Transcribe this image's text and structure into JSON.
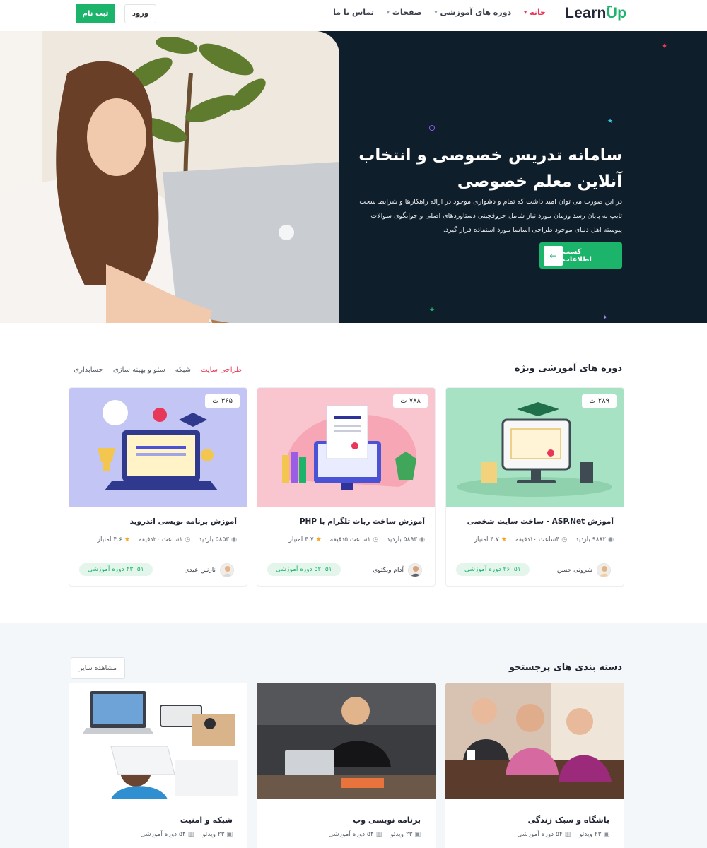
{
  "header": {
    "logo_main": "Learn",
    "logo_accent": "Up",
    "nav": [
      {
        "label": "خانه",
        "has_dropdown": true
      },
      {
        "label": "دوره های آموزشی",
        "has_dropdown": true
      },
      {
        "label": "صفحات",
        "has_dropdown": true
      },
      {
        "label": "تماس با ما",
        "has_dropdown": false
      }
    ],
    "login_label": "ورود",
    "register_label": "ثبت نام"
  },
  "hero": {
    "title": "سامانه تدریس خصوصی و انتخاب آنلاین معلم خصوصی",
    "description": "در این صورت می توان امید داشت که تمام و دشواری موجود در ارائه راهکارها و شرایط سخت تایپ به پایان رسد وزمان مورد نیاز شامل حروفچینی دستاوردهای اصلی و جوابگوی سوالات پیوسته اهل دنیای موجود طراحی اساسا مورد استفاده قرار گیرد.",
    "cta_label": "کسب اطلاعات",
    "cta_icon": "arrow-left-icon"
  },
  "featured": {
    "title": "دوره های آموزشی ویژه",
    "tabs": [
      "طراحی سایت",
      "شبکه",
      "سئو و بهینه سازی",
      "حسابداری"
    ],
    "active_tab": "طراحی سایت",
    "courses": [
      {
        "price": "۲۸۹ ت",
        "title": "آموزش ASP.Net - ساخت سایت شخصی",
        "views": "۹۸۸۲ بازدید",
        "duration": "۴ساعت ۱۰دقیقه",
        "rating": "۴.۷ امتیاز",
        "author": "شرونی حسن",
        "badge": "۲۶ دوره آموزشی",
        "badge_icon": "۵۱",
        "theme_color": "#a8e2c4"
      },
      {
        "price": "۷۸۸ ت",
        "title": "آموزش ساخت ربات تلگرام با PHP",
        "views": "۵۸۹۳ بازدید",
        "duration": "۱ساعت ۵دقیقه",
        "rating": "۴.۷ امتیاز",
        "author": "آدام ویکتوی",
        "badge": "۵۲ دوره آموزشی",
        "badge_icon": "۵۱",
        "theme_color": "#f9c6cf"
      },
      {
        "price": "۳۶۵ ت",
        "title": "آموزش برنامه نویسی اندروید",
        "views": "۵۸۵۳ بازدید",
        "duration": "۱ساعت ۲۰دقیقه",
        "rating": "۴.۶ امتیاز",
        "author": "نازنین عیدی",
        "badge": "۴۳ دوره آموزشی",
        "badge_icon": "۵۱",
        "theme_color": "#c3c6f5"
      }
    ]
  },
  "categories": {
    "title": "دسته بندی های پرجستجو",
    "more_label": "مشاهده سایر",
    "items": [
      {
        "title": "باشگاه و سبک زندگی",
        "videos": "۲۳ ویدئو",
        "courses": "۵۴ دوره آموزشی"
      },
      {
        "title": "برنامه نویسی وب",
        "videos": "۲۳ ویدئو",
        "courses": "۵۴ دوره آموزشی"
      },
      {
        "title": "شبکه و امنیت",
        "videos": "۲۳ ویدئو",
        "courses": "۵۴ دوره آموزشی"
      }
    ]
  },
  "colors": {
    "brand_green": "#1cb36a",
    "accent_pink": "#e8385a",
    "hero_bg": "#0f1e2b",
    "section_bg": "#f4f7fa"
  }
}
